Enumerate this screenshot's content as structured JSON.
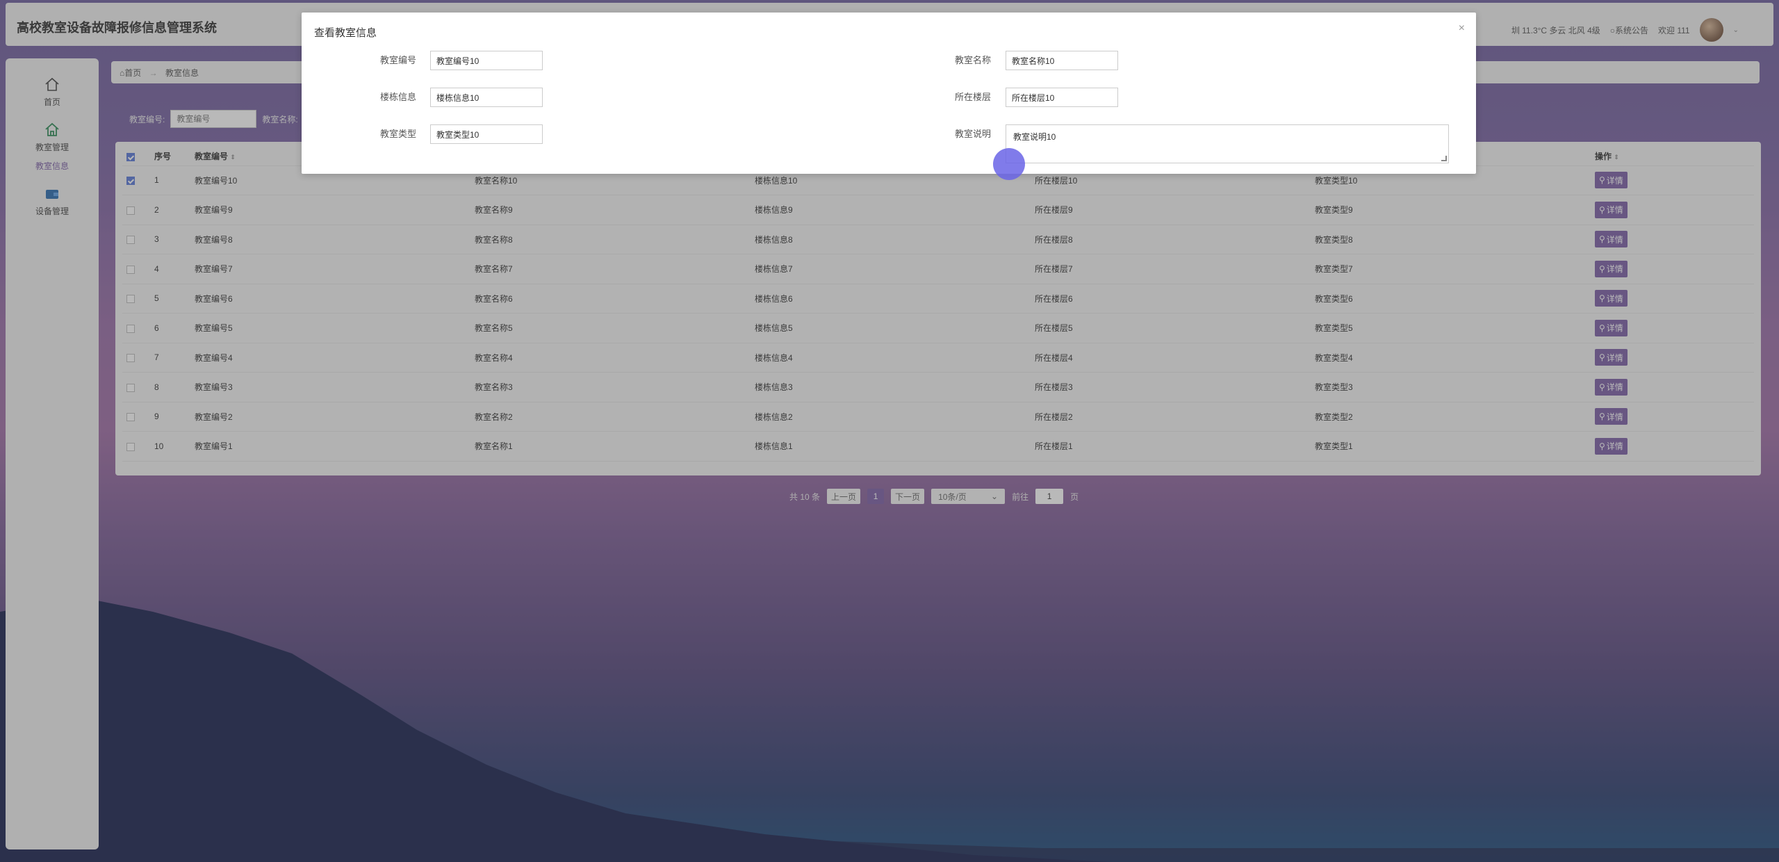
{
  "app": {
    "title": "高校教室设备故障报修信息管理系统"
  },
  "header": {
    "weather": "圳 11.3°C 多云 北风 4级",
    "notice": "系统公告",
    "welcome": "欢迎 111"
  },
  "sidebar": {
    "items": [
      {
        "label": "首页",
        "icon": "home-icon"
      },
      {
        "label": "教室管理",
        "icon": "house-icon"
      },
      {
        "label": "设备管理",
        "icon": "wallet-icon"
      }
    ],
    "sub_item": "教室信息"
  },
  "breadcrumb": {
    "home": "首页",
    "sep": "→",
    "current": "教室信息"
  },
  "search": {
    "label1": "教室编号:",
    "placeholder1": "教室编号",
    "label2": "教室名称:"
  },
  "table": {
    "headers": [
      "序号",
      "教室编号",
      "",
      "",
      "",
      "",
      "操作"
    ],
    "action_label": "详情",
    "rows": [
      {
        "idx": "1",
        "code": "教室编号10",
        "name": "教室名称10",
        "building": "楼栋信息10",
        "floor": "所在楼层10",
        "type": "教室类型10",
        "checked": true
      },
      {
        "idx": "2",
        "code": "教室编号9",
        "name": "教室名称9",
        "building": "楼栋信息9",
        "floor": "所在楼层9",
        "type": "教室类型9",
        "checked": false
      },
      {
        "idx": "3",
        "code": "教室编号8",
        "name": "教室名称8",
        "building": "楼栋信息8",
        "floor": "所在楼层8",
        "type": "教室类型8",
        "checked": false
      },
      {
        "idx": "4",
        "code": "教室编号7",
        "name": "教室名称7",
        "building": "楼栋信息7",
        "floor": "所在楼层7",
        "type": "教室类型7",
        "checked": false
      },
      {
        "idx": "5",
        "code": "教室编号6",
        "name": "教室名称6",
        "building": "楼栋信息6",
        "floor": "所在楼层6",
        "type": "教室类型6",
        "checked": false
      },
      {
        "idx": "6",
        "code": "教室编号5",
        "name": "教室名称5",
        "building": "楼栋信息5",
        "floor": "所在楼层5",
        "type": "教室类型5",
        "checked": false
      },
      {
        "idx": "7",
        "code": "教室编号4",
        "name": "教室名称4",
        "building": "楼栋信息4",
        "floor": "所在楼层4",
        "type": "教室类型4",
        "checked": false
      },
      {
        "idx": "8",
        "code": "教室编号3",
        "name": "教室名称3",
        "building": "楼栋信息3",
        "floor": "所在楼层3",
        "type": "教室类型3",
        "checked": false
      },
      {
        "idx": "9",
        "code": "教室编号2",
        "name": "教室名称2",
        "building": "楼栋信息2",
        "floor": "所在楼层2",
        "type": "教室类型2",
        "checked": false
      },
      {
        "idx": "10",
        "code": "教室编号1",
        "name": "教室名称1",
        "building": "楼栋信息1",
        "floor": "所在楼层1",
        "type": "教室类型1",
        "checked": false
      }
    ]
  },
  "pager": {
    "total": "共 10 条",
    "prev": "上一页",
    "page": "1",
    "next": "下一页",
    "size": "10条/页",
    "goto": "前往",
    "goto_value": "1",
    "page_unit": "页"
  },
  "modal": {
    "title": "查看教室信息",
    "close": "×",
    "fields": {
      "code_label": "教室编号",
      "code_value": "教室编号10",
      "name_label": "教室名称",
      "name_value": "教室名称10",
      "building_label": "楼栋信息",
      "building_value": "楼栋信息10",
      "floor_label": "所在楼层",
      "floor_value": "所在楼层10",
      "type_label": "教室类型",
      "type_value": "教室类型10",
      "desc_label": "教室说明",
      "desc_value": "教室说明10"
    }
  },
  "colors": {
    "accent": "#7c5fa6",
    "checkbox": "#5b7ad8"
  }
}
